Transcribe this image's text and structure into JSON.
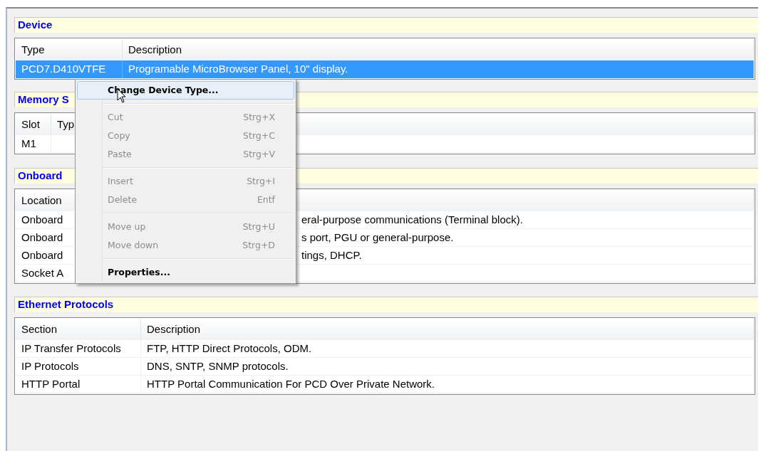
{
  "sections": [
    {
      "title": "Device",
      "columns": [
        "Type",
        "Description"
      ],
      "rows": [
        {
          "cells": [
            "PCD7.D410VTFE",
            "Programable MicroBrowser Panel, 10\" display."
          ],
          "selected": true
        }
      ]
    },
    {
      "title": "Memory S",
      "columns": [
        "Slot",
        "Typ"
      ],
      "rows": [
        {
          "cells": [
            "M1"
          ],
          "selected": false
        }
      ]
    },
    {
      "title": "Onboard",
      "columns": [
        "Location"
      ],
      "rows": [
        {
          "cells": [
            "Onboard",
            "eral-purpose communications (Terminal block)."
          ],
          "selected": false
        },
        {
          "cells": [
            "Onboard",
            "s port, PGU or general-purpose."
          ],
          "selected": false
        },
        {
          "cells": [
            "Onboard",
            "tings, DHCP."
          ],
          "selected": false
        },
        {
          "cells": [
            "Socket A"
          ],
          "selected": false
        }
      ]
    },
    {
      "title": "Ethernet Protocols",
      "columns": [
        "Section",
        "Description"
      ],
      "rows": [
        {
          "cells": [
            "IP Transfer Protocols",
            "FTP, HTTP Direct Protocols, ODM."
          ],
          "selected": false
        },
        {
          "cells": [
            "IP Protocols",
            "DNS, SNTP, SNMP protocols."
          ],
          "selected": false
        },
        {
          "cells": [
            "HTTP Portal",
            "HTTP Portal Communication For PCD Over Private Network."
          ],
          "selected": false
        }
      ]
    }
  ],
  "context_menu": {
    "items": [
      {
        "kind": "item",
        "label": "Change Device Type...",
        "disabled": false,
        "selected": true
      },
      {
        "kind": "separator"
      },
      {
        "kind": "item",
        "label": "Cut",
        "shortcut": "Strg+X",
        "disabled": true,
        "selected": false
      },
      {
        "kind": "item",
        "label": "Copy",
        "shortcut": "Strg+C",
        "disabled": true,
        "selected": false
      },
      {
        "kind": "item",
        "label": "Paste",
        "shortcut": "Strg+V",
        "disabled": true,
        "selected": false
      },
      {
        "kind": "separator"
      },
      {
        "kind": "item",
        "label": "Insert",
        "shortcut": "Strg+I",
        "disabled": true,
        "selected": false
      },
      {
        "kind": "item",
        "label": "Delete",
        "shortcut": "Entf",
        "disabled": true,
        "selected": false
      },
      {
        "kind": "separator"
      },
      {
        "kind": "item",
        "label": "Move up",
        "shortcut": "Strg+U",
        "disabled": true,
        "selected": false
      },
      {
        "kind": "item",
        "label": "Move down",
        "shortcut": "Strg+D",
        "disabled": true,
        "selected": false
      },
      {
        "kind": "separator"
      },
      {
        "kind": "item",
        "label": "Properties...",
        "disabled": false,
        "selected": false
      }
    ]
  }
}
